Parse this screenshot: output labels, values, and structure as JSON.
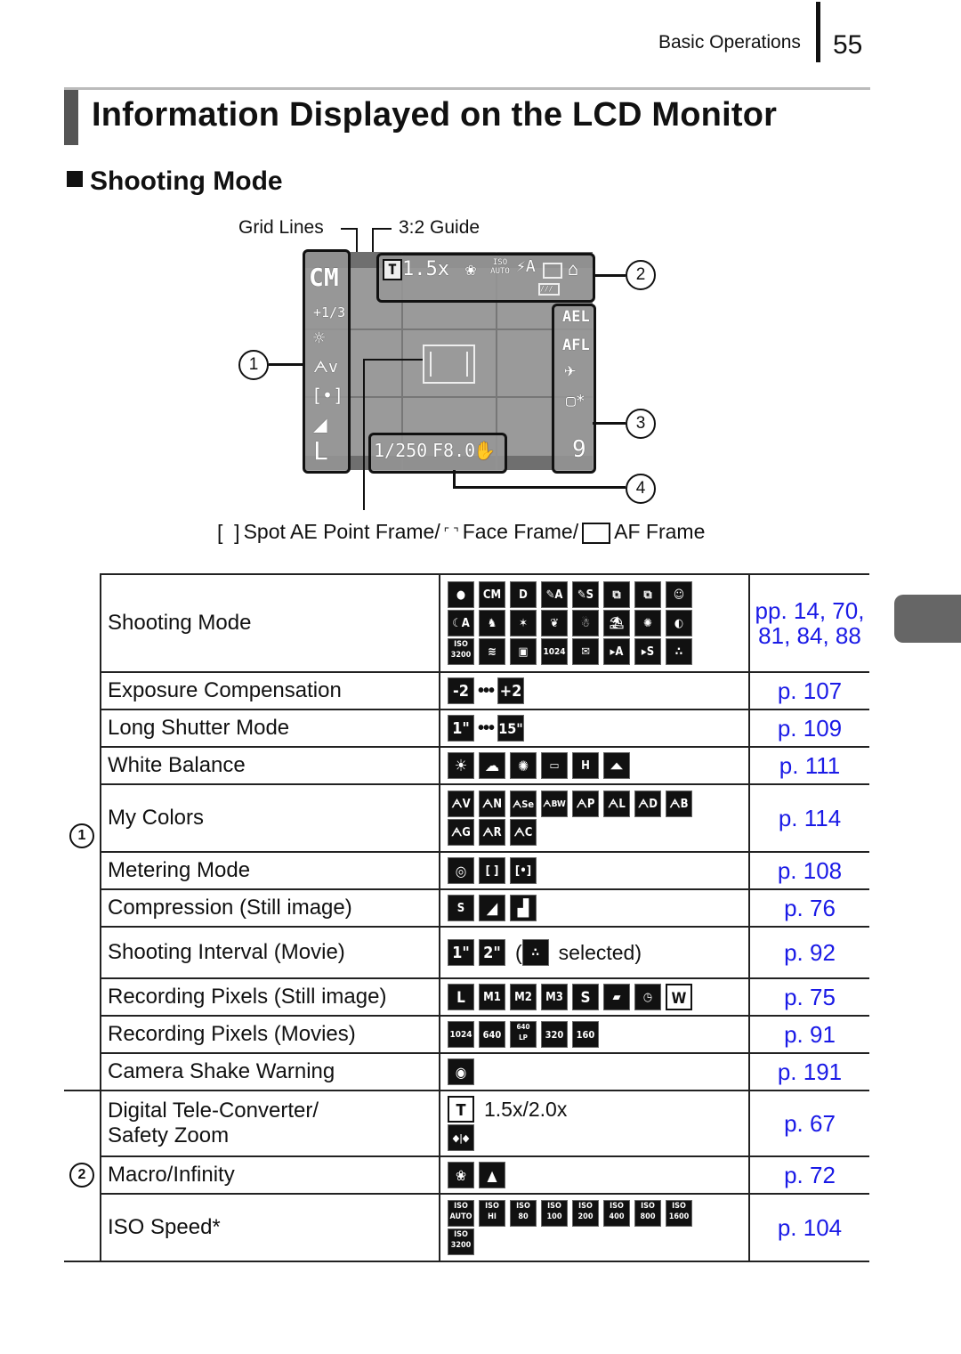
{
  "header": {
    "section_name": "Basic Operations",
    "page_number": "55"
  },
  "title": "Information Displayed on the LCD Monitor",
  "subsection": "Shooting Mode",
  "diagram": {
    "labels": {
      "grid_lines": "Grid Lines",
      "guide_32": "3:2 Guide"
    },
    "callouts": [
      "1",
      "2",
      "3",
      "4"
    ],
    "lcd": {
      "left_panel": [
        "CM",
        "+1/3",
        "sunny-wb-icon",
        "my-colors-vivid-icon",
        "metering-icon",
        "compression-icon",
        "L"
      ],
      "top_panel": {
        "tele": "T",
        "zoom": "1.5x",
        "iso": "ISO AUTO",
        "flash": "⚡A"
      },
      "right_panel": [
        "AEL",
        "AFL",
        "✈",
        "custom-icon",
        "9"
      ],
      "bottom_panel": {
        "shutter": "1/250",
        "aperture": "F8.0"
      }
    },
    "legend": {
      "spot": "Spot AE Point Frame/",
      "face": "Face Frame/",
      "af": "AF Frame"
    }
  },
  "table": {
    "group_labels": {
      "g1": "1",
      "g2": "2"
    },
    "rows": [
      {
        "item": "Shooting Mode",
        "ref": "pp. 14, 70, 81, 84, 88",
        "icons": [
          "AUTO",
          "CM",
          "D",
          "✎A",
          "✎S",
          "⧉",
          "⧉",
          "☺",
          "☾A",
          "♞",
          "✶",
          "❦",
          "☃",
          "⛱",
          "✺",
          "◐",
          "ISO 3200",
          "≋",
          "▣",
          "1024",
          "✉",
          "▸A",
          "▸S",
          "∴"
        ]
      },
      {
        "item": "Exposure Compensation",
        "ref": "p. 107",
        "icons": [
          "-2",
          "+2"
        ],
        "sep": "•••"
      },
      {
        "item": "Long Shutter Mode",
        "ref": "p. 109",
        "icons": [
          "1\"",
          "15\""
        ],
        "sep": "•••"
      },
      {
        "item": "White Balance",
        "ref": "p. 111",
        "icons": [
          "☀",
          "☁",
          "✺",
          "▭",
          "H",
          "◢◣"
        ]
      },
      {
        "item": "My Colors",
        "ref": "p. 114",
        "icons": [
          "V",
          "N",
          "Se",
          "BW",
          "P",
          "L",
          "D",
          "B",
          "G",
          "R",
          "C"
        ]
      },
      {
        "item": "Metering Mode",
        "ref": "p. 108",
        "icons": [
          "◎",
          "[ ]",
          "[•]"
        ]
      },
      {
        "item": "Compression (Still image)",
        "ref": "p. 76",
        "icons": [
          "S",
          "◢",
          "▟"
        ]
      },
      {
        "item": "Shooting Interval (Movie)",
        "ref": "p. 92",
        "icons": [
          "1\"",
          "2\""
        ],
        "note": "selected)"
      },
      {
        "item": "Recording Pixels (Still image)",
        "ref": "p. 75",
        "icons": [
          "L",
          "M1",
          "M2",
          "M3",
          "S",
          "▰",
          "◷",
          "W"
        ]
      },
      {
        "item": "Recording Pixels (Movies)",
        "ref": "p. 91",
        "icons": [
          "1024",
          "640",
          "640LP",
          "320",
          "160"
        ]
      },
      {
        "item": "Camera Shake Warning",
        "ref": "p. 191",
        "icons": [
          "✋"
        ]
      },
      {
        "item": "Digital Tele-Converter/ Safety Zoom",
        "item_line1": "Digital Tele-Converter/",
        "item_line2": "Safety Zoom",
        "ref": "p. 67",
        "icons": [
          "T",
          "◆|◆"
        ],
        "note": "1.5x/2.0x"
      },
      {
        "item": "Macro/Infinity",
        "ref": "p. 72",
        "icons": [
          "❀",
          "▲"
        ]
      },
      {
        "item": "ISO Speed*",
        "ref": "p. 104",
        "icons": [
          "AUTO",
          "HI",
          "80",
          "100",
          "200",
          "400",
          "800",
          "1600",
          "3200"
        ]
      }
    ]
  }
}
